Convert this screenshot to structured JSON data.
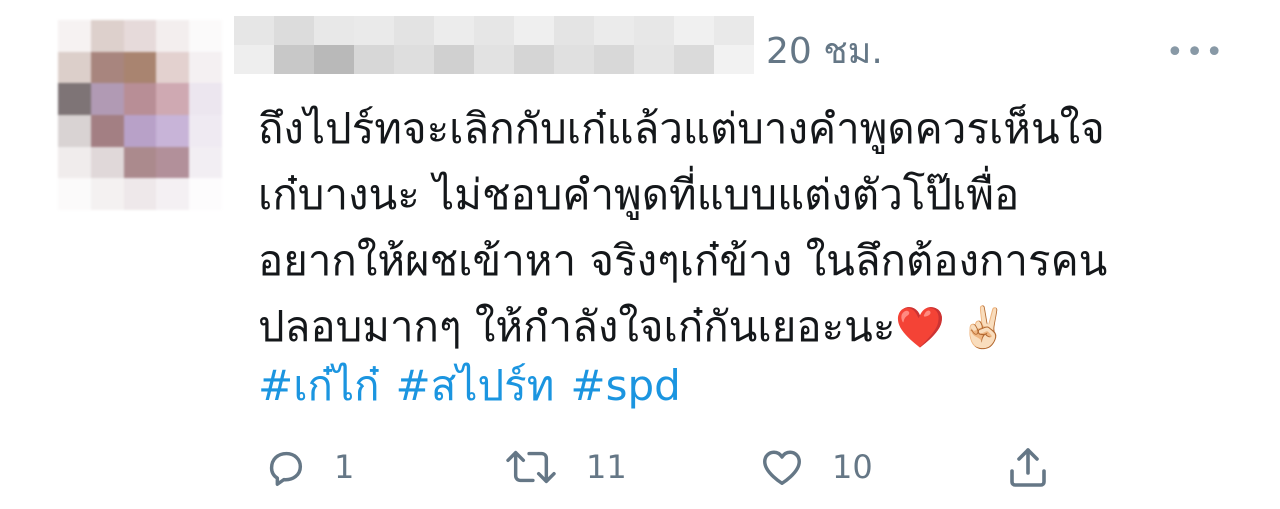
{
  "tweet": {
    "time": "20 ชม.",
    "more_icon": "more-icon",
    "text_lines": [
      "ถึงไปร์ทจะเลิกกับเก๋แล้วแต่บางคำพูดควรเห็นใจ",
      "เก๋บางนะ ไม่ชอบคำพูดที่แบบแต่งตัวโป๊เพื่อ",
      "อยากให้ผชเข้าหา จริงๆเก๋ข้าง ในลึกต้องการคน",
      "ปลอบมากๆ  ให้กำลังใจเก๋กันเยอะนะ"
    ],
    "emojis": [
      "❤️",
      "✌🏻"
    ],
    "hashtags": [
      "#เก๋ไก๋",
      "#สไปร์ท",
      "#spd"
    ],
    "actions": {
      "reply": {
        "icon": "reply-icon",
        "count": "1"
      },
      "retweet": {
        "icon": "retweet-icon",
        "count": "11"
      },
      "like": {
        "icon": "heart-icon",
        "count": "10"
      },
      "share": {
        "icon": "share-icon"
      }
    }
  },
  "colors": {
    "text": "#14171a",
    "secondary": "#657786",
    "hashtag": "#1b95e0",
    "icon": "#657786"
  }
}
